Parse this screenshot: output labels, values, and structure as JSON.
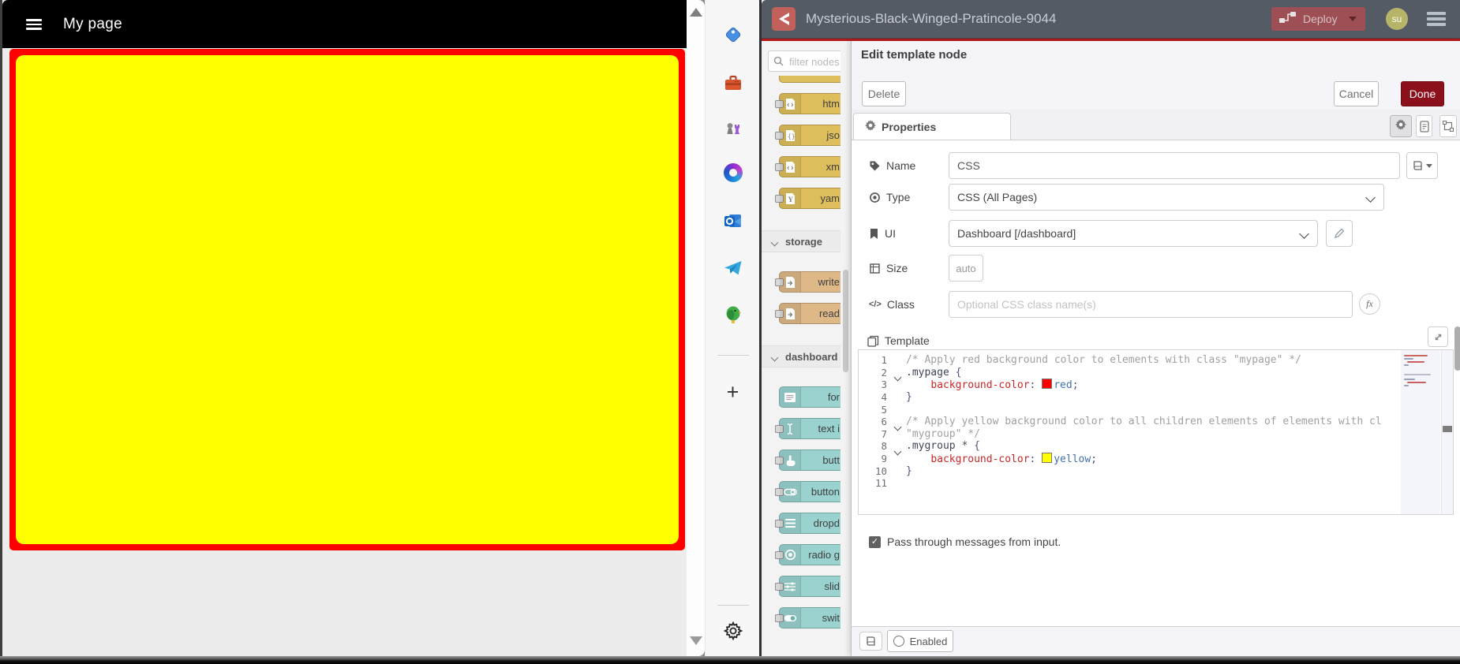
{
  "dashboard_page": {
    "title": "My page",
    "colors": {
      "header_bg": "#000000",
      "page_bg": "#ececec",
      "group_border": "#ff0000",
      "widget_bg": "#ffff00"
    }
  },
  "browser_sidebar": {
    "icons": [
      "tag-icon",
      "toolbox-icon",
      "chess-icon",
      "m365-icon",
      "outlook-icon",
      "telegram-icon",
      "parrot-icon"
    ],
    "plus_label": "+"
  },
  "nodered": {
    "header": {
      "title": "Mysterious-Black-Winged-Pratincole-9044",
      "deploy_label": "Deploy",
      "avatar_initials": "su"
    },
    "palette": {
      "search_placeholder": "filter nodes",
      "sections": [
        {
          "header": null,
          "color": "#DEBD5C",
          "nodes": [
            {
              "label": "htm",
              "icon": "file-code"
            },
            {
              "label": "jso",
              "icon": "file-braces"
            },
            {
              "label": "xm",
              "icon": "file-code"
            },
            {
              "label": "yam",
              "icon": "file-y"
            }
          ]
        },
        {
          "header": "storage",
          "color": "#DEB887",
          "nodes": [
            {
              "label": "write",
              "icon": "file-in"
            },
            {
              "label": "read",
              "icon": "file-out"
            }
          ]
        },
        {
          "header": "dashboard",
          "color": "#99D2CE",
          "nodes": [
            {
              "label": "for",
              "icon": "form",
              "no_port": true
            },
            {
              "label": "text i",
              "icon": "text-cursor"
            },
            {
              "label": "butt",
              "icon": "hand-pointer"
            },
            {
              "label": "button",
              "icon": "toggle"
            },
            {
              "label": "dropd",
              "icon": "list"
            },
            {
              "label": "radio g",
              "icon": "radio"
            },
            {
              "label": "slid",
              "icon": "sliders"
            },
            {
              "label": "swit",
              "icon": "toggle-on"
            }
          ]
        }
      ]
    },
    "tray": {
      "title": "Edit template node",
      "delete_label": "Delete",
      "cancel_label": "Cancel",
      "done_label": "Done",
      "done_color": "#8C101C",
      "tab_label": "Properties",
      "fields": {
        "name_label": "Name",
        "name_value": "CSS",
        "type_label": "Type",
        "type_value": "CSS (All Pages)",
        "ui_label": "UI",
        "ui_value": "Dashboard [/dashboard]",
        "size_label": "Size",
        "size_value": "auto",
        "class_label": "Class",
        "class_placeholder": "Optional CSS class name(s)",
        "template_label": "Template"
      },
      "code_lines": [
        {
          "n": "1",
          "fold": false,
          "tokens": [
            {
              "c": "cmt",
              "t": "/* Apply red background color to elements with class \"mypage\" */"
            }
          ]
        },
        {
          "n": "2",
          "fold": true,
          "tokens": [
            {
              "c": "sel",
              "t": ".mypage"
            },
            {
              "c": "pln",
              "t": " {"
            }
          ]
        },
        {
          "n": "3",
          "fold": false,
          "tokens": [
            {
              "c": "pln",
              "t": "    "
            },
            {
              "c": "prop",
              "t": "background-color"
            },
            {
              "c": "pln",
              "t": ": "
            },
            {
              "c": "swatch",
              "color": "#ff0000"
            },
            {
              "c": "val",
              "t": "red"
            },
            {
              "c": "pln",
              "t": ";"
            }
          ]
        },
        {
          "n": "4",
          "fold": false,
          "tokens": [
            {
              "c": "pln",
              "t": "}"
            }
          ]
        },
        {
          "n": "5",
          "fold": false,
          "tokens": []
        },
        {
          "n": "6",
          "fold": true,
          "tokens": [
            {
              "c": "cmt",
              "t": "/* Apply yellow background color to all children elements of elements with cl"
            }
          ]
        },
        {
          "n": "7",
          "fold": false,
          "tokens": [
            {
              "c": "cmt",
              "t": "\"mygroup\" */"
            }
          ]
        },
        {
          "n": "8",
          "fold": true,
          "tokens": [
            {
              "c": "sel",
              "t": ".mygroup"
            },
            {
              "c": "pln",
              "t": " "
            },
            {
              "c": "star",
              "t": "*"
            },
            {
              "c": "pln",
              "t": " {"
            }
          ]
        },
        {
          "n": "9",
          "fold": false,
          "tokens": [
            {
              "c": "pln",
              "t": "    "
            },
            {
              "c": "prop",
              "t": "background-color"
            },
            {
              "c": "pln",
              "t": ": "
            },
            {
              "c": "swatch",
              "color": "#ffff00"
            },
            {
              "c": "val",
              "t": "yellow"
            },
            {
              "c": "pln",
              "t": ";"
            }
          ]
        },
        {
          "n": "10",
          "fold": false,
          "tokens": [
            {
              "c": "pln",
              "t": "}"
            }
          ]
        },
        {
          "n": "11",
          "fold": false,
          "tokens": []
        }
      ],
      "passthrough_label": "Pass through messages from input.",
      "enabled_label": "Enabled"
    }
  }
}
